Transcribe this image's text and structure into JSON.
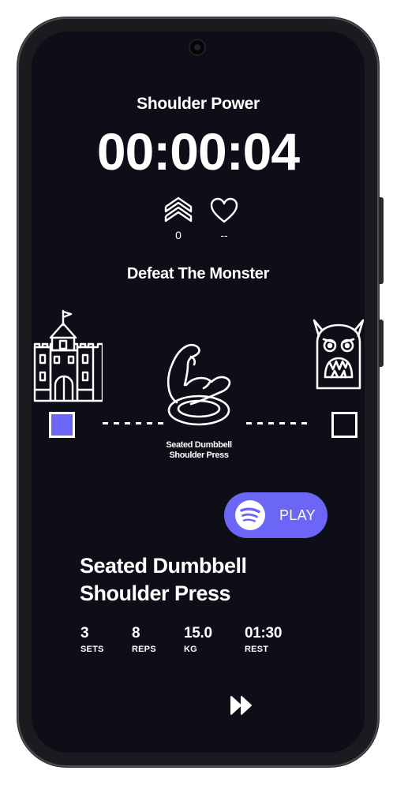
{
  "header": {
    "workout_title": "Shoulder Power",
    "timer": "00:00:04"
  },
  "stats": {
    "level_value": "0",
    "heart_rate_value": "--"
  },
  "mission": {
    "title": "Defeat The Monster",
    "progress_fraction": 0.5
  },
  "current_exercise_caption": {
    "line1": "Seated Dumbbell",
    "line2": "Shoulder Press"
  },
  "music": {
    "play_label": "PLAY",
    "accent_color": "#6b66f5"
  },
  "exercise": {
    "name_line1": "Seated Dumbbell",
    "name_line2": "Shoulder Press",
    "details": [
      {
        "value": "3",
        "label": "SETS"
      },
      {
        "value": "8",
        "label": "REPS"
      },
      {
        "value": "15.0",
        "label": "KG"
      },
      {
        "value": "01:30",
        "label": "REST"
      }
    ]
  },
  "icons": {
    "level": "chevrons-up-icon",
    "heart": "heart-icon",
    "castle": "castle-icon",
    "exercise": "flexed-arm-icon",
    "monster": "monster-icon",
    "spotify": "spotify-icon",
    "skip": "fast-forward-icon"
  },
  "colors": {
    "background": "#0d0e17",
    "text": "#ffffff",
    "accent": "#6b66f5"
  }
}
